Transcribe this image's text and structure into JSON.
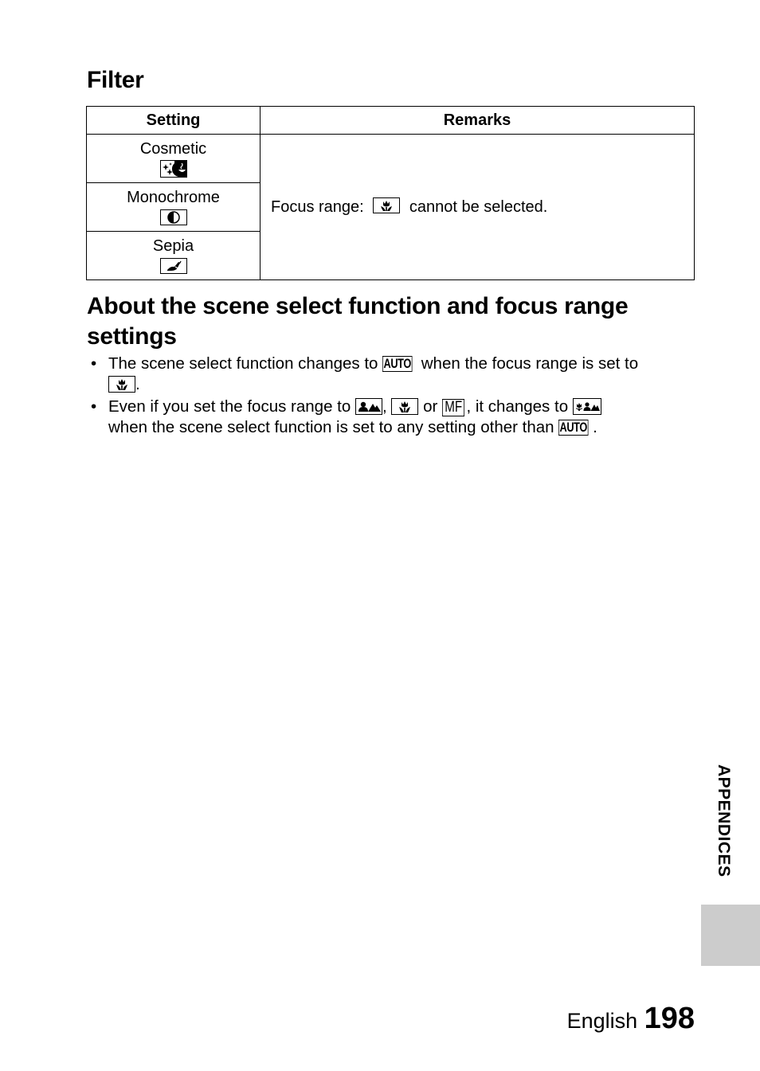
{
  "filter_section": {
    "title": "Filter",
    "table": {
      "headers": [
        "Setting",
        "Remarks"
      ],
      "rows": [
        {
          "setting": "Cosmetic",
          "icon": "cosmetic-icon"
        },
        {
          "setting": "Monochrome",
          "icon": "monochrome-icon"
        },
        {
          "setting": "Sepia",
          "icon": "sepia-icon"
        }
      ],
      "remarks": {
        "prefix": "Focus range:",
        "icon": "macro-tulip-icon",
        "suffix": "cannot be selected."
      }
    }
  },
  "about_section": {
    "title": "About the scene select function and focus range settings",
    "notes": [
      {
        "parts": [
          "The scene select function changes to",
          "AUTO",
          "when the focus range is set to",
          "macro-tulip-icon",
          "."
        ]
      },
      {
        "parts": [
          "Even if you set the focus range to",
          "landscape-icon",
          ",",
          "macro-tulip-icon",
          "or",
          "MF",
          ", it changes to",
          "macro-landscape-icon",
          "when the scene select function is set to any setting other than",
          "AUTO",
          "."
        ]
      }
    ],
    "auto_label": "AUTO",
    "mf_label": "MF",
    "bullet": "•"
  },
  "side_tab": {
    "label": "APPENDICES",
    "color": "#cccccc"
  },
  "footer": {
    "language": "English",
    "page_number": "198"
  }
}
